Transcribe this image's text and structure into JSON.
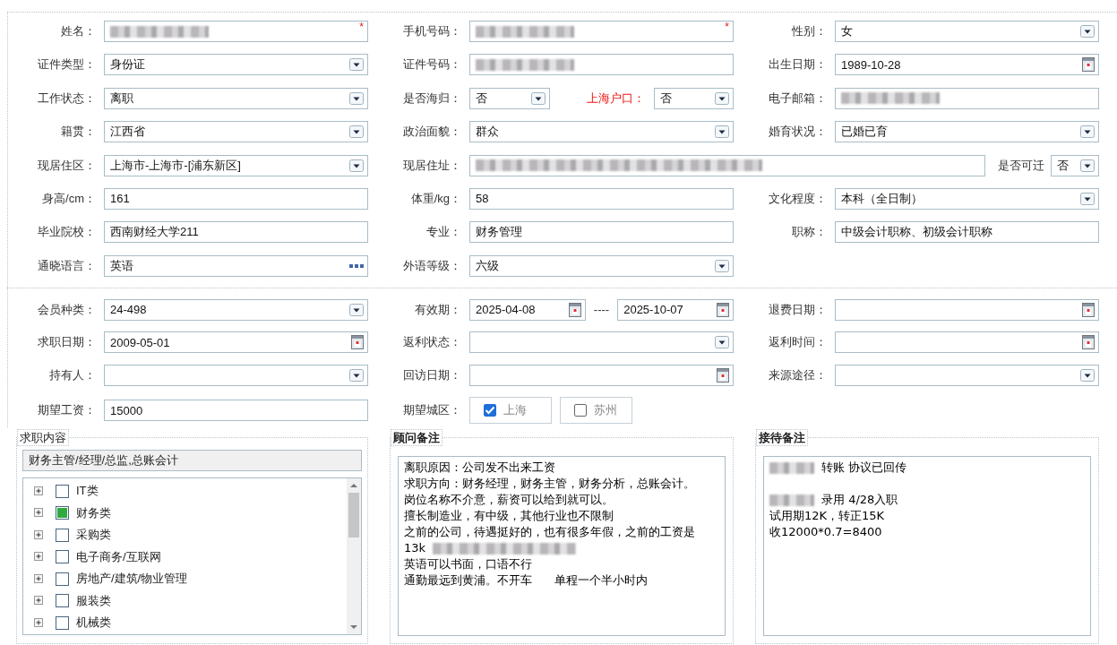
{
  "sections": [
    {
      "rows": [
        {
          "cells": [
            {
              "items": [
                {
                  "kind": "label",
                  "text": "姓名："
                },
                {
                  "kind": "text",
                  "redacted": true,
                  "required_mark": "*"
                }
              ]
            },
            {
              "items": [
                {
                  "kind": "label",
                  "text": "手机号码："
                },
                {
                  "kind": "text",
                  "redacted": true,
                  "required_mark": "*"
                }
              ]
            },
            {
              "items": [
                {
                  "kind": "label",
                  "text": "性别："
                },
                {
                  "kind": "select",
                  "value": "女"
                }
              ]
            }
          ]
        },
        {
          "cells": [
            {
              "items": [
                {
                  "kind": "label",
                  "text": "证件类型："
                },
                {
                  "kind": "select",
                  "value": "身份证"
                }
              ]
            },
            {
              "items": [
                {
                  "kind": "label",
                  "text": "证件号码："
                },
                {
                  "kind": "text",
                  "redacted": true
                }
              ]
            },
            {
              "items": [
                {
                  "kind": "label",
                  "text": "出生日期："
                },
                {
                  "kind": "date",
                  "value": "1989-10-28"
                }
              ]
            }
          ]
        },
        {
          "cells": [
            {
              "items": [
                {
                  "kind": "label",
                  "text": "工作状态："
                },
                {
                  "kind": "select",
                  "value": "离职"
                }
              ]
            },
            {
              "items": [
                {
                  "kind": "label",
                  "text": "是否海归："
                },
                {
                  "kind": "select",
                  "value": "否"
                },
                {
                  "kind": "label",
                  "text": "上海户口：",
                  "highlighted": true
                },
                {
                  "kind": "select",
                  "value": "否"
                }
              ]
            },
            {
              "items": [
                {
                  "kind": "label",
                  "text": "电子邮箱："
                },
                {
                  "kind": "text",
                  "redacted": true
                }
              ]
            }
          ]
        },
        {
          "cells": [
            {
              "items": [
                {
                  "kind": "label",
                  "text": "籍贯："
                },
                {
                  "kind": "select",
                  "value": "江西省"
                }
              ]
            },
            {
              "items": [
                {
                  "kind": "label",
                  "text": "政治面貌："
                },
                {
                  "kind": "select",
                  "value": "群众"
                }
              ]
            },
            {
              "items": [
                {
                  "kind": "label",
                  "text": "婚育状况："
                },
                {
                  "kind": "select",
                  "value": "已婚已育"
                }
              ]
            }
          ]
        },
        {
          "cells": [
            {
              "items": [
                {
                  "kind": "label",
                  "text": "现居住区："
                },
                {
                  "kind": "select",
                  "value": "上海市-上海市-[浦东新区]"
                }
              ]
            },
            {
              "wide": true,
              "items": [
                {
                  "kind": "label",
                  "text": "现居住址："
                },
                {
                  "kind": "text",
                  "redacted": true
                },
                {
                  "kind": "label",
                  "text": "是否可迁"
                },
                {
                  "kind": "select",
                  "value": "否"
                }
              ]
            }
          ]
        },
        {
          "cells": [
            {
              "items": [
                {
                  "kind": "label",
                  "text": "身高/cm："
                },
                {
                  "kind": "text",
                  "value": "161"
                }
              ]
            },
            {
              "items": [
                {
                  "kind": "label",
                  "text": "体重/kg："
                },
                {
                  "kind": "text",
                  "value": "58"
                }
              ]
            },
            {
              "items": [
                {
                  "kind": "label",
                  "text": "文化程度："
                },
                {
                  "kind": "select",
                  "value": "本科（全日制）"
                }
              ]
            }
          ]
        },
        {
          "cells": [
            {
              "items": [
                {
                  "kind": "label",
                  "text": "毕业院校："
                },
                {
                  "kind": "text",
                  "value": "西南财经大学211"
                }
              ]
            },
            {
              "items": [
                {
                  "kind": "label",
                  "text": "专业："
                },
                {
                  "kind": "text",
                  "value": "财务管理"
                }
              ]
            },
            {
              "items": [
                {
                  "kind": "label",
                  "text": "职称："
                },
                {
                  "kind": "text",
                  "value": "中级会计职称、初级会计职称"
                }
              ]
            }
          ]
        },
        {
          "cells": [
            {
              "items": [
                {
                  "kind": "label",
                  "text": "通晓语言："
                },
                {
                  "kind": "lookup",
                  "value": "英语"
                }
              ]
            },
            {
              "items": [
                {
                  "kind": "label",
                  "text": "外语等级："
                },
                {
                  "kind": "select",
                  "value": "六级"
                }
              ]
            }
          ]
        }
      ]
    },
    {
      "rows": [
        {
          "cells": [
            {
              "items": [
                {
                  "kind": "label",
                  "text": "会员种类："
                },
                {
                  "kind": "select",
                  "value": "24-498"
                }
              ]
            },
            {
              "items": [
                {
                  "kind": "label",
                  "text": "有效期："
                },
                {
                  "kind": "date",
                  "value": "2025-04-08"
                },
                {
                  "kind": "separator",
                  "text": "----"
                },
                {
                  "kind": "date",
                  "value": "2025-10-07"
                }
              ]
            },
            {
              "items": [
                {
                  "kind": "label",
                  "text": "退费日期："
                },
                {
                  "kind": "date"
                }
              ]
            }
          ]
        },
        {
          "cells": [
            {
              "items": [
                {
                  "kind": "label",
                  "text": "求职日期："
                },
                {
                  "kind": "date",
                  "value": "2009-05-01"
                }
              ]
            },
            {
              "items": [
                {
                  "kind": "label",
                  "text": "返利状态："
                },
                {
                  "kind": "select"
                }
              ]
            },
            {
              "items": [
                {
                  "kind": "label",
                  "text": "返利时间："
                },
                {
                  "kind": "date"
                }
              ]
            }
          ]
        },
        {
          "cells": [
            {
              "items": [
                {
                  "kind": "label",
                  "text": "持有人："
                },
                {
                  "kind": "select"
                }
              ]
            },
            {
              "items": [
                {
                  "kind": "label",
                  "text": "回访日期："
                },
                {
                  "kind": "date"
                }
              ]
            },
            {
              "items": [
                {
                  "kind": "label",
                  "text": "来源途径："
                },
                {
                  "kind": "select"
                }
              ]
            }
          ]
        },
        {
          "cells": [
            {
              "items": [
                {
                  "kind": "label",
                  "text": "期望工资："
                },
                {
                  "kind": "text",
                  "value": "15000"
                }
              ]
            },
            {
              "items": [
                {
                  "kind": "label",
                  "text": "期望城区："
                },
                {
                  "kind": "checkbox",
                  "text": "上海",
                  "checked": true
                },
                {
                  "kind": "checkbox",
                  "text": "苏州",
                  "checked": false
                }
              ]
            }
          ]
        }
      ]
    }
  ],
  "panels": [
    {
      "kind": "tree",
      "title": "求职内容",
      "bold": false,
      "selection": "财务主管/经理/总监,总账会计",
      "items": [
        {
          "label": "IT类",
          "checked": false,
          "expanded": false
        },
        {
          "label": "财务类",
          "checked": true,
          "expanded": false
        },
        {
          "label": "采购类",
          "checked": false,
          "expanded": false
        },
        {
          "label": "电子商务/互联网",
          "checked": false,
          "expanded": false
        },
        {
          "label": "房地产/建筑/物业管理",
          "checked": false,
          "expanded": false
        },
        {
          "label": "服装类",
          "checked": false,
          "expanded": false
        },
        {
          "label": "机械类",
          "checked": false,
          "expanded": false
        }
      ]
    },
    {
      "kind": "notes",
      "title": "顾问备注",
      "bold": true,
      "lines": [
        {
          "kind": "text",
          "segments": [
            {
              "kind": "text",
              "text": "离职原因：公司发不出来工资"
            }
          ]
        },
        {
          "kind": "text",
          "segments": [
            {
              "kind": "text",
              "text": "求职方向：财务经理，财务主管，财务分析，总账会计。"
            }
          ]
        },
        {
          "kind": "text",
          "segments": [
            {
              "kind": "text",
              "text": "岗位名称不介意，薪资可以给到就可以。"
            }
          ]
        },
        {
          "kind": "text",
          "segments": [
            {
              "kind": "text",
              "text": "擅长制造业，有中级，其他行业也不限制"
            }
          ]
        },
        {
          "kind": "text",
          "segments": [
            {
              "kind": "text",
              "text": "之前的公司，待遇挺好的，也有很多年假，之前的工资是"
            }
          ]
        },
        {
          "kind": "text",
          "segments": [
            {
              "kind": "text",
              "text": "13k"
            },
            {
              "kind": "redacted"
            }
          ]
        },
        {
          "kind": "text",
          "segments": [
            {
              "kind": "text",
              "text": "英语可以书面，口语不行"
            }
          ]
        },
        {
          "kind": "text",
          "segments": [
            {
              "kind": "text",
              "text": "通勤最远到黄浦。不开车      单程一个半小时内"
            }
          ]
        }
      ]
    },
    {
      "kind": "notes",
      "title": "接待备注",
      "bold": true,
      "lines": [
        {
          "kind": "text",
          "segments": [
            {
              "kind": "redacted"
            },
            {
              "kind": "text",
              "text": "转账 协议已回传"
            }
          ]
        },
        {
          "kind": "blank"
        },
        {
          "kind": "text",
          "segments": [
            {
              "kind": "redacted"
            },
            {
              "kind": "text",
              "text": "录用 4/28入职"
            }
          ]
        },
        {
          "kind": "text",
          "segments": [
            {
              "kind": "text",
              "text": "试用期12K，转正15K"
            }
          ]
        },
        {
          "kind": "text",
          "segments": [
            {
              "kind": "text",
              "text": "收12000*0.7=8400"
            }
          ]
        }
      ]
    }
  ]
}
